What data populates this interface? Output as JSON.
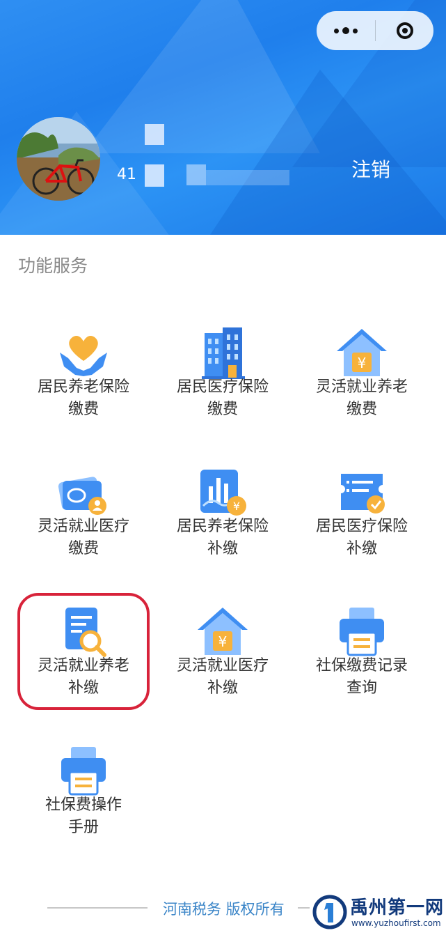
{
  "capsule": {
    "more_icon": "more-dots-icon",
    "close_icon": "circle-close-icon"
  },
  "header": {
    "user_id_prefix": "41",
    "logout_label": "注销",
    "background_color": "#2388ef"
  },
  "section": {
    "title": "功能服务"
  },
  "services": [
    {
      "line1": "居民养老保险",
      "line2": "缴费",
      "icon": "heart-hands-icon"
    },
    {
      "line1": "居民医疗保险",
      "line2": "缴费",
      "icon": "building-icon"
    },
    {
      "line1": "灵活就业养老",
      "line2": "缴费",
      "icon": "house-yen-icon"
    },
    {
      "line1": "灵活就业医疗",
      "line2": "缴费",
      "icon": "card-user-icon"
    },
    {
      "line1": "居民养老保险",
      "line2": "补缴",
      "icon": "chart-yen-icon"
    },
    {
      "line1": "居民医疗保险",
      "line2": "补缴",
      "icon": "ticket-check-icon"
    },
    {
      "line1": "灵活就业养老",
      "line2": "补缴",
      "icon": "document-search-icon"
    },
    {
      "line1": "灵活就业医疗",
      "line2": "补缴",
      "icon": "house-yen-icon"
    },
    {
      "line1": "社保缴费记录",
      "line2": "查询",
      "icon": "printer-icon"
    },
    {
      "line1": "社保费操作",
      "line2": "手册",
      "icon": "printer-icon"
    }
  ],
  "highlight_color": "#d8233a",
  "footer": {
    "copyright": "河南税务 版权所有"
  },
  "watermark": {
    "name": "禹州第一网",
    "url": "www.yuzhoufirst.com"
  }
}
